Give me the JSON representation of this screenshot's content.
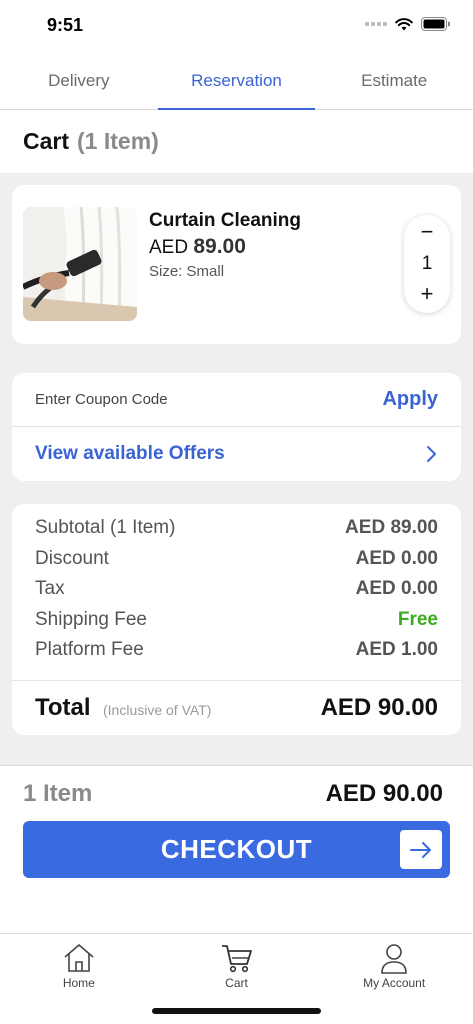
{
  "status": {
    "time": "9:51"
  },
  "tabs": [
    {
      "label": "Delivery"
    },
    {
      "label": "Reservation"
    },
    {
      "label": "Estimate"
    }
  ],
  "cart": {
    "title": "Cart",
    "count": "(1 Item)"
  },
  "item": {
    "name": "Curtain Cleaning",
    "currency": "AED",
    "price": "89.00",
    "size": "Size: Small",
    "quantity": "1",
    "minus": "−",
    "plus": "+"
  },
  "coupon": {
    "placeholder": "Enter Coupon Code",
    "apply_label": "Apply",
    "offers_label": "View available Offers"
  },
  "summary": {
    "rows": [
      {
        "label": "Subtotal (1 Item)",
        "value": "AED 89.00"
      },
      {
        "label": "Discount",
        "value": "AED 0.00"
      },
      {
        "label": "Tax",
        "value": "AED 0.00"
      },
      {
        "label": "Shipping Fee",
        "value": "Free"
      },
      {
        "label": "Platform Fee",
        "value": "AED 1.00"
      }
    ],
    "total_label": "Total",
    "total_note": "(Inclusive of VAT)",
    "total_value": "AED 90.00"
  },
  "checkout": {
    "items_label": "1 Item",
    "total": "AED 90.00",
    "button_label": "CHECKOUT"
  },
  "tabbar": [
    {
      "label": "Home",
      "icon": "home-icon"
    },
    {
      "label": "Cart",
      "icon": "cart-icon"
    },
    {
      "label": "My Account",
      "icon": "user-icon"
    }
  ],
  "colors": {
    "accent": "#3a63d6",
    "checkout": "#3a6ae0",
    "free": "#3eaa1f",
    "background": "#efefef"
  }
}
